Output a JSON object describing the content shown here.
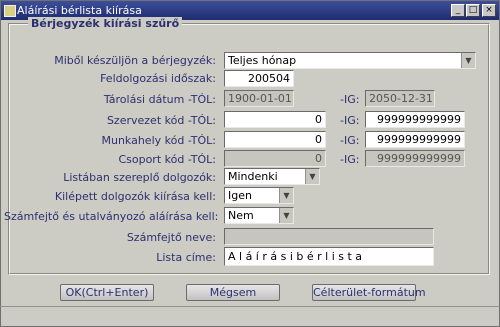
{
  "window": {
    "title": "Aláírási bérlista kiírása"
  },
  "titlebar": {
    "minimize": "_",
    "maximize": "□",
    "close": "×"
  },
  "group": {
    "title": "Bérjegyzék kiírási szűrő"
  },
  "labels": {
    "source": "Miből készüljön a bérjegyzék:",
    "period": "Feldolgozási időszak:",
    "storage_date": "Tárolási dátum -TÓL:",
    "org_code": "Szervezet kód -TÓL:",
    "workplace_code": "Munkahely kód -TÓL:",
    "group_code": "Csoport kód -TÓL:",
    "ig": "-IG:",
    "listed_employees": "Listában szereplő dolgozók:",
    "left_employees": "Kilépett dolgozók kiírása kell:",
    "signature": "Számfejtő és utalványozó aláírása kell:",
    "clerk_name": "Számfejtő neve:",
    "list_title": "Lista címe:"
  },
  "fields": {
    "source": "Teljes hónap",
    "period": "200504",
    "storage_from": "1900-01-01",
    "storage_to": "2050-12-31",
    "org_from": "0",
    "org_to": "999999999999",
    "workplace_from": "0",
    "workplace_to": "999999999999",
    "group_from": "0",
    "group_to": "999999999999",
    "listed_employees": "Mindenki",
    "left_employees": "Igen",
    "signature": "Nem",
    "clerk_name": "",
    "list_title": "A l á í r á s i   b é r l i s t a"
  },
  "buttons": {
    "ok": "OK(Ctrl+Enter)",
    "cancel": "Mégsem",
    "target": "Célterület-formátum"
  },
  "icons": {
    "dropdown": "▼"
  }
}
